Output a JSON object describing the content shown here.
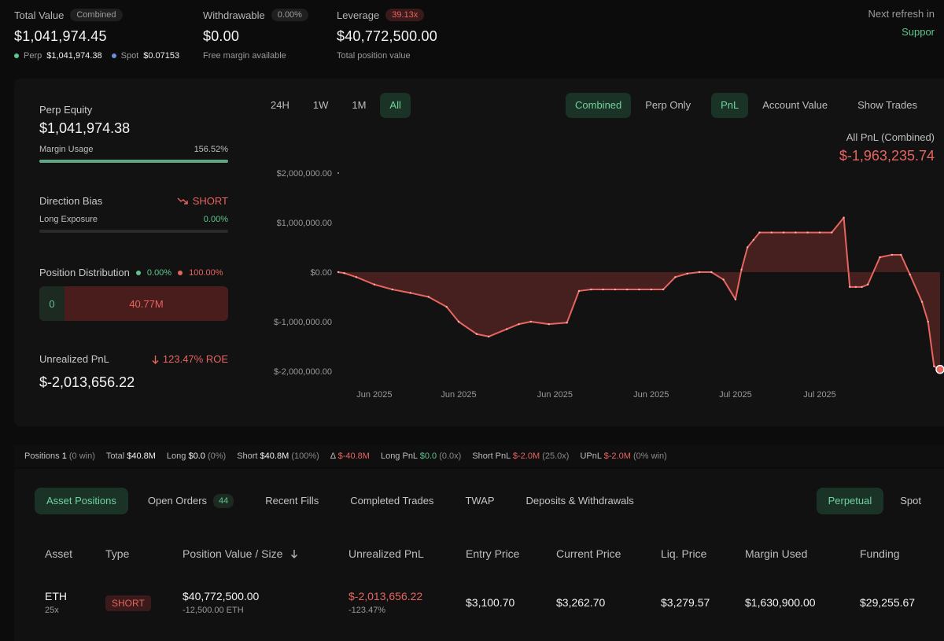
{
  "header": {
    "total_value": {
      "label": "Total Value",
      "badge": "Combined",
      "value": "$1,041,974.45",
      "perp_label": "Perp",
      "perp_value": "$1,041,974.38",
      "spot_label": "Spot",
      "spot_value": "$0.07153"
    },
    "withdrawable": {
      "label": "Withdrawable",
      "badge": "0.00%",
      "value": "$0.00",
      "sub": "Free margin available"
    },
    "leverage": {
      "label": "Leverage",
      "badge": "39.13x",
      "value": "$40,772,500.00",
      "sub": "Total position value"
    },
    "refresh": {
      "label": "Next refresh in",
      "support": "Suppor"
    }
  },
  "sidebar": {
    "perp_equity": {
      "label": "Perp Equity",
      "value": "$1,041,974.38",
      "margin_label": "Margin Usage",
      "margin_value": "156.52%",
      "margin_fill": 1.0
    },
    "direction": {
      "label": "Direction Bias",
      "value": "SHORT",
      "long_label": "Long Exposure",
      "long_value": "0.00%",
      "long_fill": 0.0
    },
    "distribution": {
      "label": "Position Distribution",
      "long_pct": "0.00%",
      "short_pct": "100.00%",
      "long_amount": "0",
      "short_amount": "40.77M"
    },
    "unrealized": {
      "label": "Unrealized PnL",
      "roe": "123.47% ROE",
      "value": "$-2,013,656.22"
    }
  },
  "chart_tabs": {
    "range": [
      "24H",
      "1W",
      "1M",
      "All"
    ],
    "range_selected": "All",
    "mode": [
      "Combined",
      "Perp Only"
    ],
    "mode_selected": "Combined",
    "metric": [
      "PnL",
      "Account Value"
    ],
    "metric_selected": "PnL",
    "show_trades": "Show Trades"
  },
  "chart_header": {
    "title": "All PnL (Combined)",
    "value": "$-1,963,235.74"
  },
  "chart_data": {
    "type": "area",
    "ytick_labels": [
      "$2,000,000.00",
      "$1,000,000.00",
      "$0.00",
      "$-1,000,000.00",
      "$-2,000,000.00"
    ],
    "yticks": [
      2000000,
      1000000,
      0,
      -1000000,
      -2000000
    ],
    "xtick_labels": [
      "Jun 2025",
      "Jun 2025",
      "Jun 2025",
      "Jun 2025",
      "Jul 2025",
      "Jul 2025"
    ],
    "xtick_pos": [
      0.06,
      0.2,
      0.36,
      0.52,
      0.66,
      0.8
    ],
    "ylim": [
      -2000000,
      2000000
    ],
    "x": [
      0,
      0.01,
      0.03,
      0.06,
      0.09,
      0.12,
      0.15,
      0.18,
      0.2,
      0.23,
      0.25,
      0.28,
      0.3,
      0.32,
      0.35,
      0.38,
      0.4,
      0.42,
      0.44,
      0.46,
      0.48,
      0.5,
      0.52,
      0.54,
      0.56,
      0.58,
      0.6,
      0.62,
      0.64,
      0.66,
      0.67,
      0.68,
      0.69,
      0.7,
      0.72,
      0.74,
      0.76,
      0.78,
      0.8,
      0.82,
      0.84,
      0.85,
      0.86,
      0.87,
      0.88,
      0.9,
      0.92,
      0.935,
      0.95,
      0.97,
      0.98,
      0.99,
      1.0
    ],
    "y": [
      0,
      -20000,
      -100000,
      -250000,
      -350000,
      -420000,
      -500000,
      -700000,
      -1000000,
      -1250000,
      -1300000,
      -1150000,
      -1050000,
      -1000000,
      -1050000,
      -1020000,
      -380000,
      -350000,
      -350000,
      -350000,
      -350000,
      -350000,
      -350000,
      -350000,
      -100000,
      -30000,
      0,
      0,
      -150000,
      -550000,
      50000,
      500000,
      650000,
      800000,
      800000,
      800000,
      800000,
      800000,
      800000,
      800000,
      1100000,
      -300000,
      -300000,
      -300000,
      -250000,
      300000,
      350000,
      350000,
      -50000,
      -600000,
      -1000000,
      -1900000,
      -1963235
    ]
  },
  "summary": {
    "positions_label": "Positions",
    "positions_value": "1",
    "positions_win": "(0 win)",
    "total_label": "Total",
    "total_value": "$40.8M",
    "long_label": "Long",
    "long_value": "$0.0",
    "long_pct": "(0%)",
    "short_label": "Short",
    "short_value": "$40.8M",
    "short_pct": "(100%)",
    "delta_label": "Δ",
    "delta_value": "$-40.8M",
    "longpnl_label": "Long PnL",
    "longpnl_value": "$0.0",
    "longpnl_x": "(0.0x)",
    "shortpnl_label": "Short PnL",
    "shortpnl_value": "$-2.0M",
    "shortpnl_x": "(25.0x)",
    "upnl_label": "UPnL",
    "upnl_value": "$-2.0M",
    "upnl_win": "(0% win)"
  },
  "bottom_tabs": {
    "asset_positions": "Asset Positions",
    "open_orders": "Open Orders",
    "open_orders_count": "44",
    "recent_fills": "Recent Fills",
    "completed_trades": "Completed Trades",
    "twap": "TWAP",
    "deposits": "Deposits & Withdrawals",
    "perpetual": "Perpetual",
    "spot": "Spot"
  },
  "table": {
    "headers": {
      "asset": "Asset",
      "type": "Type",
      "position": "Position Value / Size",
      "upnl": "Unrealized PnL",
      "entry": "Entry Price",
      "current": "Current Price",
      "liq": "Liq. Price",
      "margin": "Margin Used",
      "funding": "Funding"
    },
    "sort_icon": "arrow-down-icon",
    "row": {
      "asset": "ETH",
      "leverage": "25x",
      "type": "SHORT",
      "position_value": "$40,772,500.00",
      "size": "-12,500.00 ETH",
      "upnl": "$-2,013,656.22",
      "upnl_pct": "-123.47%",
      "entry": "$3,100.70",
      "current": "$3,262.70",
      "liq": "$3,279.57",
      "margin": "$1,630,900.00",
      "funding": "$29,255.67"
    }
  }
}
